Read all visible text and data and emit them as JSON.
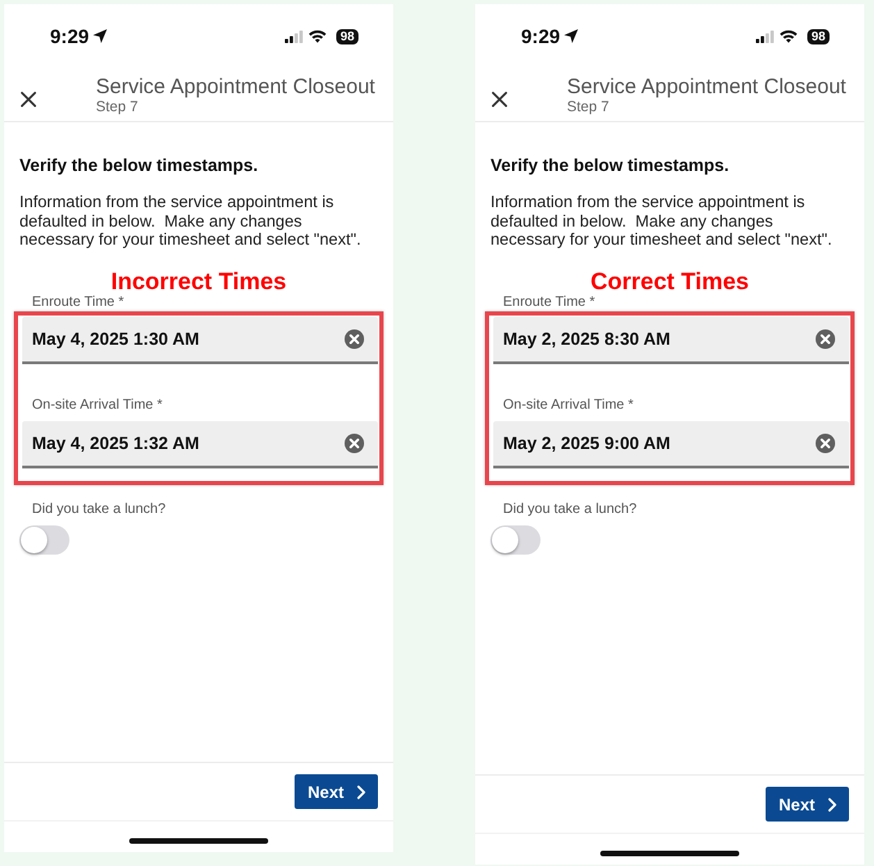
{
  "panels": [
    {
      "status_bar": {
        "time": "9:29",
        "battery": "98"
      },
      "header": {
        "title": "Service Appointment Closeout",
        "subtitle": "Step 7"
      },
      "heading": "Verify the below timestamps.",
      "instructions": "Information from the service appointment is defaulted in below.  Make any changes necessary for your timesheet and select \"next\".",
      "annotation": "Incorrect Times",
      "fields": [
        {
          "label": "Enroute Time *",
          "value": "May 4, 2025 1:30 AM"
        },
        {
          "label": "On-site Arrival Time *",
          "value": "May 4, 2025 1:32 AM"
        }
      ],
      "lunch": {
        "label": "Did you take a lunch?",
        "on": false
      },
      "next_button": "Next"
    },
    {
      "status_bar": {
        "time": "9:29",
        "battery": "98"
      },
      "header": {
        "title": "Service Appointment Closeout",
        "subtitle": "Step 7"
      },
      "heading": "Verify the below timestamps.",
      "instructions": "Information from the service appointment is defaulted in below.  Make any changes necessary for your timesheet and select \"next\".",
      "annotation": "Correct Times",
      "fields": [
        {
          "label": "Enroute Time *",
          "value": "May 2, 2025 8:30 AM"
        },
        {
          "label": "On-site Arrival Time *",
          "value": "May 2, 2025 9:00 AM"
        }
      ],
      "lunch": {
        "label": "Did you take a lunch?",
        "on": false
      },
      "next_button": "Next"
    }
  ]
}
